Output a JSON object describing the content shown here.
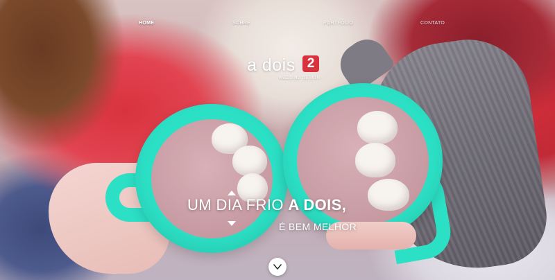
{
  "nav": {
    "items": [
      {
        "label": "HOME"
      },
      {
        "label": "SOBRE"
      },
      {
        "label": "PORTFÓLIO"
      },
      {
        "label": "CONTATO"
      }
    ]
  },
  "logo": {
    "word": "a dois",
    "badge": "2",
    "subtitle": "WEDDING DESIGN"
  },
  "hero": {
    "headline_start": "UM DIA FRIO ",
    "headline_bold": "A DOIS,",
    "headline_line2": "É BEM MELHOR"
  },
  "scroll_button": {
    "icon": "chevron-down-icon"
  },
  "colors": {
    "accent_teal": "#2ce0c5",
    "logo_red": "#d9323f",
    "text": "#ffffff"
  }
}
